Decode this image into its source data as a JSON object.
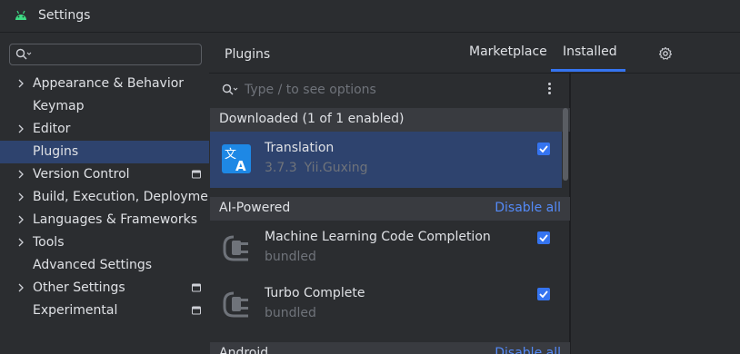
{
  "window": {
    "title": "Settings"
  },
  "sidebar": {
    "items": [
      {
        "label": "Appearance & Behavior",
        "expandable": true,
        "project_icon": false
      },
      {
        "label": "Keymap",
        "expandable": false,
        "project_icon": false
      },
      {
        "label": "Editor",
        "expandable": true,
        "project_icon": false
      },
      {
        "label": "Plugins",
        "expandable": false,
        "project_icon": false,
        "selected": true
      },
      {
        "label": "Version Control",
        "expandable": true,
        "project_icon": true
      },
      {
        "label": "Build, Execution, Deployment",
        "expandable": true,
        "project_icon": false
      },
      {
        "label": "Languages & Frameworks",
        "expandable": true,
        "project_icon": false
      },
      {
        "label": "Tools",
        "expandable": true,
        "project_icon": false
      },
      {
        "label": "Advanced Settings",
        "expandable": false,
        "project_icon": false
      },
      {
        "label": "Other Settings",
        "expandable": true,
        "project_icon": true
      },
      {
        "label": "Experimental",
        "expandable": false,
        "project_icon": true
      }
    ]
  },
  "header": {
    "title": "Plugins",
    "tabs": [
      {
        "label": "Marketplace",
        "active": false
      },
      {
        "label": "Installed",
        "active": true
      }
    ]
  },
  "filter": {
    "placeholder": "Type / to see options"
  },
  "groups": [
    {
      "label": "Downloaded (1 of 1 enabled)",
      "action": "",
      "plugins": [
        {
          "name": "Translation",
          "version": "3.7.3",
          "vendor": "Yii.Guxing",
          "checked": true,
          "icon": "translate-icon",
          "selected": true
        }
      ]
    },
    {
      "label": "AI-Powered",
      "action": "Disable all",
      "plugins": [
        {
          "name": "Machine Learning Code Completion",
          "version": "bundled",
          "vendor": "",
          "checked": true,
          "icon": "plugin-plug-icon"
        },
        {
          "name": "Turbo Complete",
          "version": "bundled",
          "vendor": "",
          "checked": true,
          "icon": "plugin-plug-icon"
        }
      ]
    },
    {
      "label": "Android",
      "action": "Disable all",
      "plugins": []
    }
  ],
  "colors": {
    "accent": "#3574f0",
    "selection": "#2e436e",
    "link": "#548af7"
  }
}
